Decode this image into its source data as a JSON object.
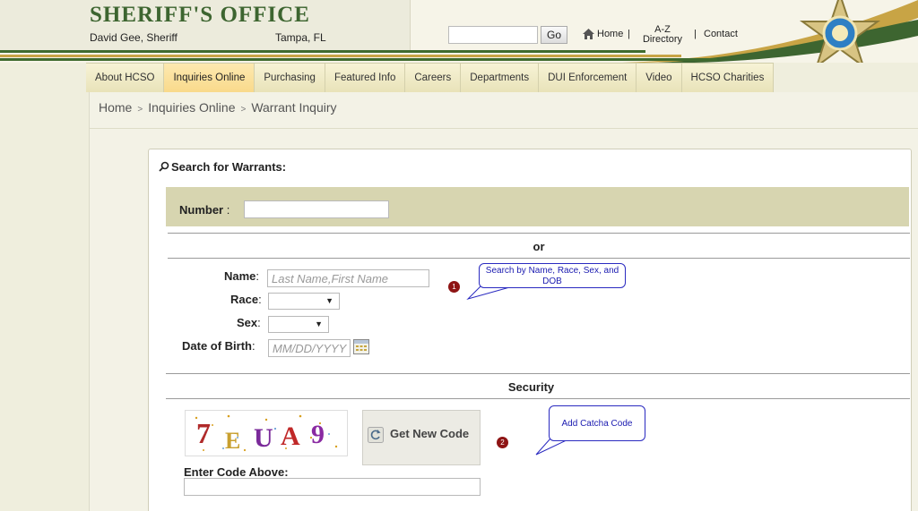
{
  "header": {
    "title": "SHERIFF'S OFFICE",
    "sheriff": "David Gee, Sheriff",
    "city": "Tampa, FL",
    "search_placeholder": "",
    "go_label": "Go",
    "home_label": "Home",
    "az_line1": "A-Z",
    "az_line2": "Directory",
    "contact_label": "Contact",
    "separator": "|",
    "home_icon": "house-icon",
    "badge_icon": "sheriff-star-badge",
    "accent_green": "#3d6530",
    "accent_gold": "#c8a445"
  },
  "nav": {
    "items": [
      {
        "label": "About HCSO"
      },
      {
        "label": "Inquiries Online"
      },
      {
        "label": "Purchasing"
      },
      {
        "label": "Featured Info"
      },
      {
        "label": "Careers"
      },
      {
        "label": "Departments"
      },
      {
        "label": "DUI Enforcement"
      },
      {
        "label": "Video"
      },
      {
        "label": "HCSO Charities"
      }
    ],
    "active": "Inquiries Online"
  },
  "breadcrumb": {
    "home": "Home",
    "inquiries": "Inquiries Online",
    "current": "Warrant Inquiry",
    "separator": ">"
  },
  "form": {
    "title": "Search for Warrants:",
    "title_icon": "magnifier-icon",
    "number_label": "Number",
    "number_colon": ":",
    "or_label": "or",
    "name_label": "Name",
    "name_placeholder": "Last Name,First Name",
    "race_label": "Race",
    "sex_label": "Sex",
    "dob_label": "Date of Birth",
    "dob_placeholder": "MM/DD/YYYY",
    "colon": ":",
    "calendar_icon": "calendar-icon",
    "select_arrow": "▼",
    "security_label": "Security",
    "get_new_code": "Get New Code",
    "enter_code_label": "Enter Code Above:",
    "captcha_chars": [
      "7",
      "E",
      "U",
      "A",
      "9"
    ]
  },
  "annotations": {
    "callout1": "Search by Name, Race, Sex, and DOB",
    "marker1": "1",
    "callout2": "Add Catcha Code",
    "marker2": "2",
    "callout_color": "#2a2ac0",
    "marker_color": "#8e1414"
  }
}
